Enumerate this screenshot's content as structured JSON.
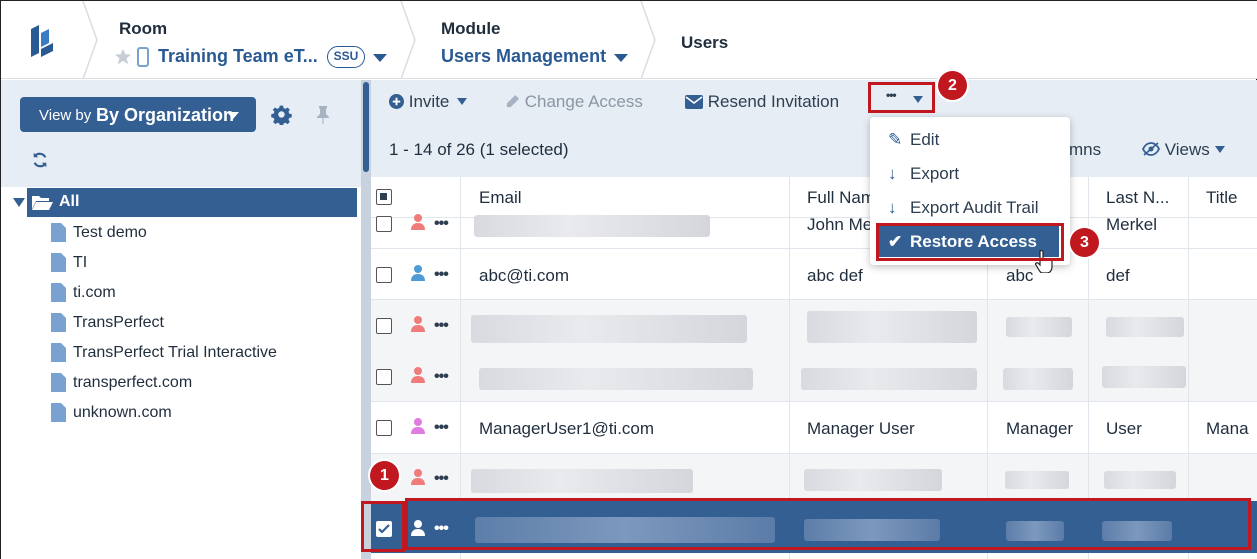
{
  "header": {
    "room_title": "Room",
    "room_value": "Training Team eT...",
    "room_badge": "SSU",
    "module_title": "Module",
    "module_value": "Users Management",
    "users_title": "Users"
  },
  "sidebar": {
    "viewby_label": "View by",
    "viewby_value": "By Organization",
    "tree_root": "All",
    "tree_items": [
      "Test demo",
      "TI",
      "ti.com",
      "TransPerfect",
      "TransPerfect Trial Interactive",
      "transperfect.com",
      "unknown.com"
    ]
  },
  "toolbar": {
    "invite": "Invite",
    "change_access": "Change Access",
    "resend": "Resend Invitation",
    "more": "•••"
  },
  "grid": {
    "count": "1 - 14 of 26 (1 selected)",
    "columns_partial": "mns",
    "views": "Views",
    "headers": {
      "email": "Email",
      "full_name": "Full Nam",
      "last_name": "Last N...",
      "title": "Title"
    },
    "rows": [
      {
        "email": "",
        "full_name": "John Me",
        "first": "",
        "last": "Merkel",
        "title": ""
      },
      {
        "email": "abc@ti.com",
        "full_name": "abc def",
        "first": "abc",
        "last": "def",
        "title": ""
      },
      {
        "email": "",
        "full_name": "",
        "first": "",
        "last": "",
        "title": ""
      },
      {
        "email": "",
        "full_name": "",
        "first": "",
        "last": "",
        "title": ""
      },
      {
        "email": "ManagerUser1@ti.com",
        "full_name": "Manager User",
        "first": "Manager",
        "last": "User",
        "title": "Mana"
      },
      {
        "email": "",
        "full_name": "",
        "first": "",
        "last": "",
        "title": ""
      },
      {
        "email": "",
        "full_name": "",
        "first": "",
        "last": "",
        "title": ""
      }
    ]
  },
  "menu": {
    "edit": "Edit",
    "export": "Export",
    "export_audit": "Export Audit Trail",
    "restore": "Restore Access"
  },
  "annotations": {
    "step1": "1",
    "step2": "2",
    "step3": "3"
  },
  "colors": {
    "brand": "#345f92",
    "accent": "#2a5a93",
    "annotation": "#c0181e",
    "sidebar_bg": "#e6edf5"
  }
}
